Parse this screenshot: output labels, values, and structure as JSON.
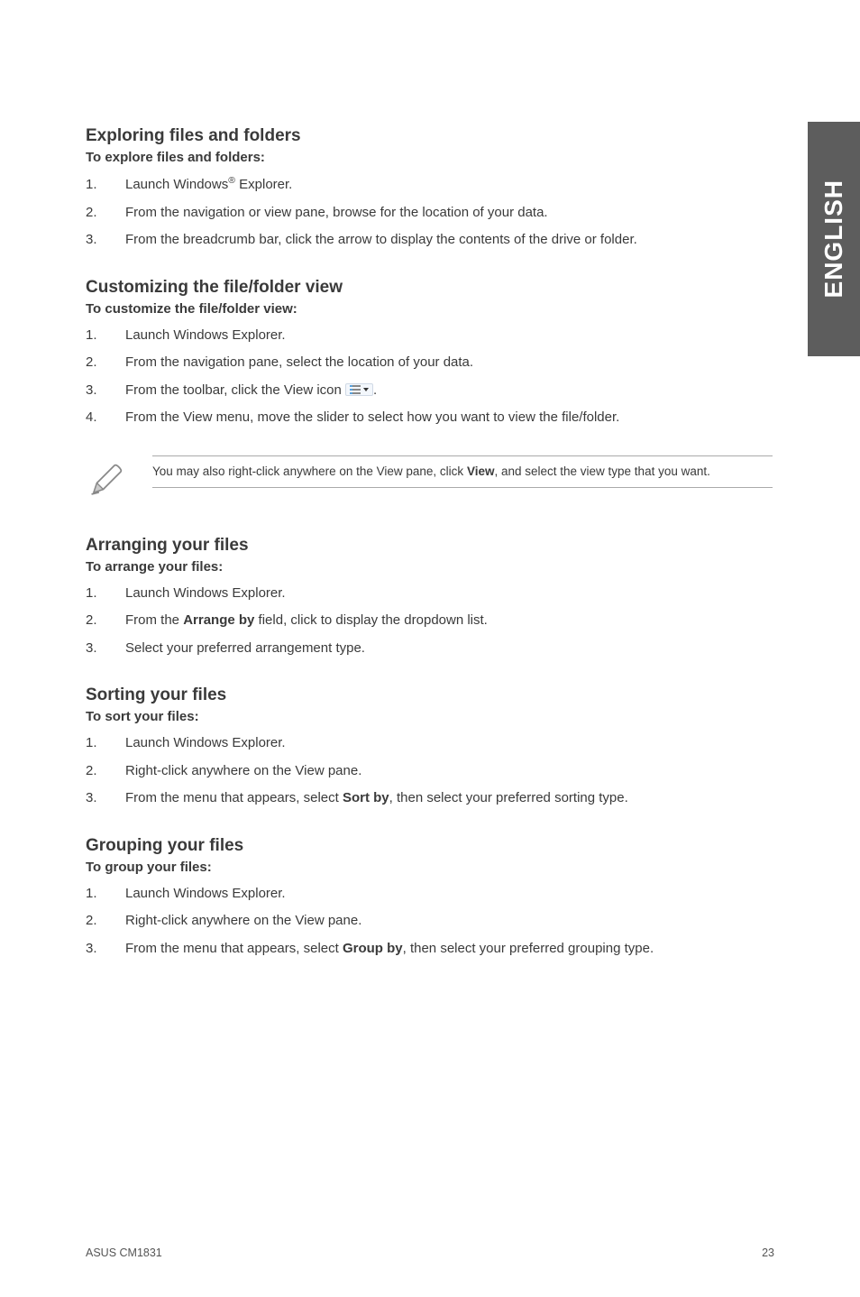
{
  "side_tab": "ENGLISH",
  "sections": {
    "exploring": {
      "heading": "Exploring files and folders",
      "subhead": "To explore files and folders:",
      "items": [
        {
          "num": "1.",
          "pre": "Launch Windows",
          "sup": "®",
          "post": " Explorer."
        },
        {
          "num": "2.",
          "text": "From the navigation or view pane, browse for the location of your data."
        },
        {
          "num": "3.",
          "text": "From the breadcrumb bar, click the arrow to display the contents of the drive or folder."
        }
      ]
    },
    "customizing": {
      "heading": "Customizing the file/folder view",
      "subhead": "To customize the file/folder view:",
      "items": [
        {
          "num": "1.",
          "text": "Launch Windows Explorer."
        },
        {
          "num": "2.",
          "text": "From the navigation pane, select the location of your data."
        },
        {
          "num": "3.",
          "pre": "From the toolbar, click the View icon ",
          "icon": "view-icon",
          "post": "."
        },
        {
          "num": "4.",
          "text": "From the View menu, move the slider to select how you want to view the file/folder."
        }
      ],
      "note": {
        "pre": "You may also right-click anywhere on the View pane, click ",
        "bold": "View",
        "post": ", and select the view type that you want."
      }
    },
    "arranging": {
      "heading": "Arranging your files",
      "subhead": "To arrange your files:",
      "items": [
        {
          "num": "1.",
          "text": "Launch Windows Explorer."
        },
        {
          "num": "2.",
          "pre": "From the ",
          "bold": "Arrange by",
          "post": " field, click to display the dropdown list."
        },
        {
          "num": "3.",
          "text": "Select your preferred arrangement type."
        }
      ]
    },
    "sorting": {
      "heading": "Sorting your files",
      "subhead": "To sort your files:",
      "items": [
        {
          "num": "1.",
          "text": "Launch Windows Explorer."
        },
        {
          "num": "2.",
          "text": "Right-click anywhere on the View pane."
        },
        {
          "num": "3.",
          "pre": "From the menu that appears, select ",
          "bold": "Sort by",
          "post": ", then select your preferred sorting type."
        }
      ]
    },
    "grouping": {
      "heading": "Grouping your files",
      "subhead": "To group your files:",
      "items": [
        {
          "num": "1.",
          "text": "Launch Windows Explorer."
        },
        {
          "num": "2.",
          "text": "Right-click anywhere on the View pane."
        },
        {
          "num": "3.",
          "pre": "From the menu that appears, select ",
          "bold": "Group by",
          "post": ", then select your preferred grouping type."
        }
      ]
    }
  },
  "footer": {
    "left": "ASUS CM1831",
    "right": "23"
  }
}
